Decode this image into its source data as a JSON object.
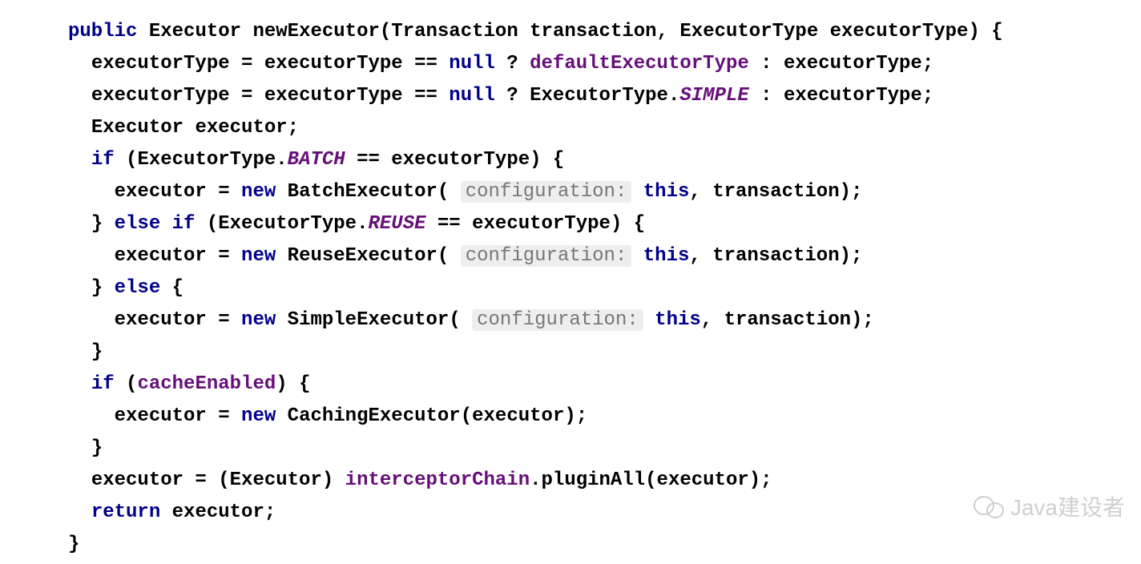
{
  "code": {
    "tokens": {
      "public": "public",
      "if": "if",
      "else": "else",
      "new": "new",
      "null": "null",
      "this": "this",
      "return": "return"
    },
    "identifiers": {
      "Executor": "Executor",
      "newExecutor": "newExecutor",
      "Transaction": "Transaction",
      "transaction": "transaction",
      "ExecutorType": "ExecutorType",
      "executorType": "executorType",
      "executor": "executor",
      "BatchExecutor": "BatchExecutor",
      "ReuseExecutor": "ReuseExecutor",
      "SimpleExecutor": "SimpleExecutor",
      "CachingExecutor": "CachingExecutor",
      "pluginAll": "pluginAll"
    },
    "fields": {
      "defaultExecutorType": "defaultExecutorType",
      "cacheEnabled": "cacheEnabled",
      "interceptorChain": "interceptorChain",
      "BATCH": "BATCH",
      "REUSE": "REUSE",
      "SIMPLE": "SIMPLE"
    },
    "hints": {
      "configuration": "configuration:"
    }
  },
  "watermark": "Java建设者"
}
